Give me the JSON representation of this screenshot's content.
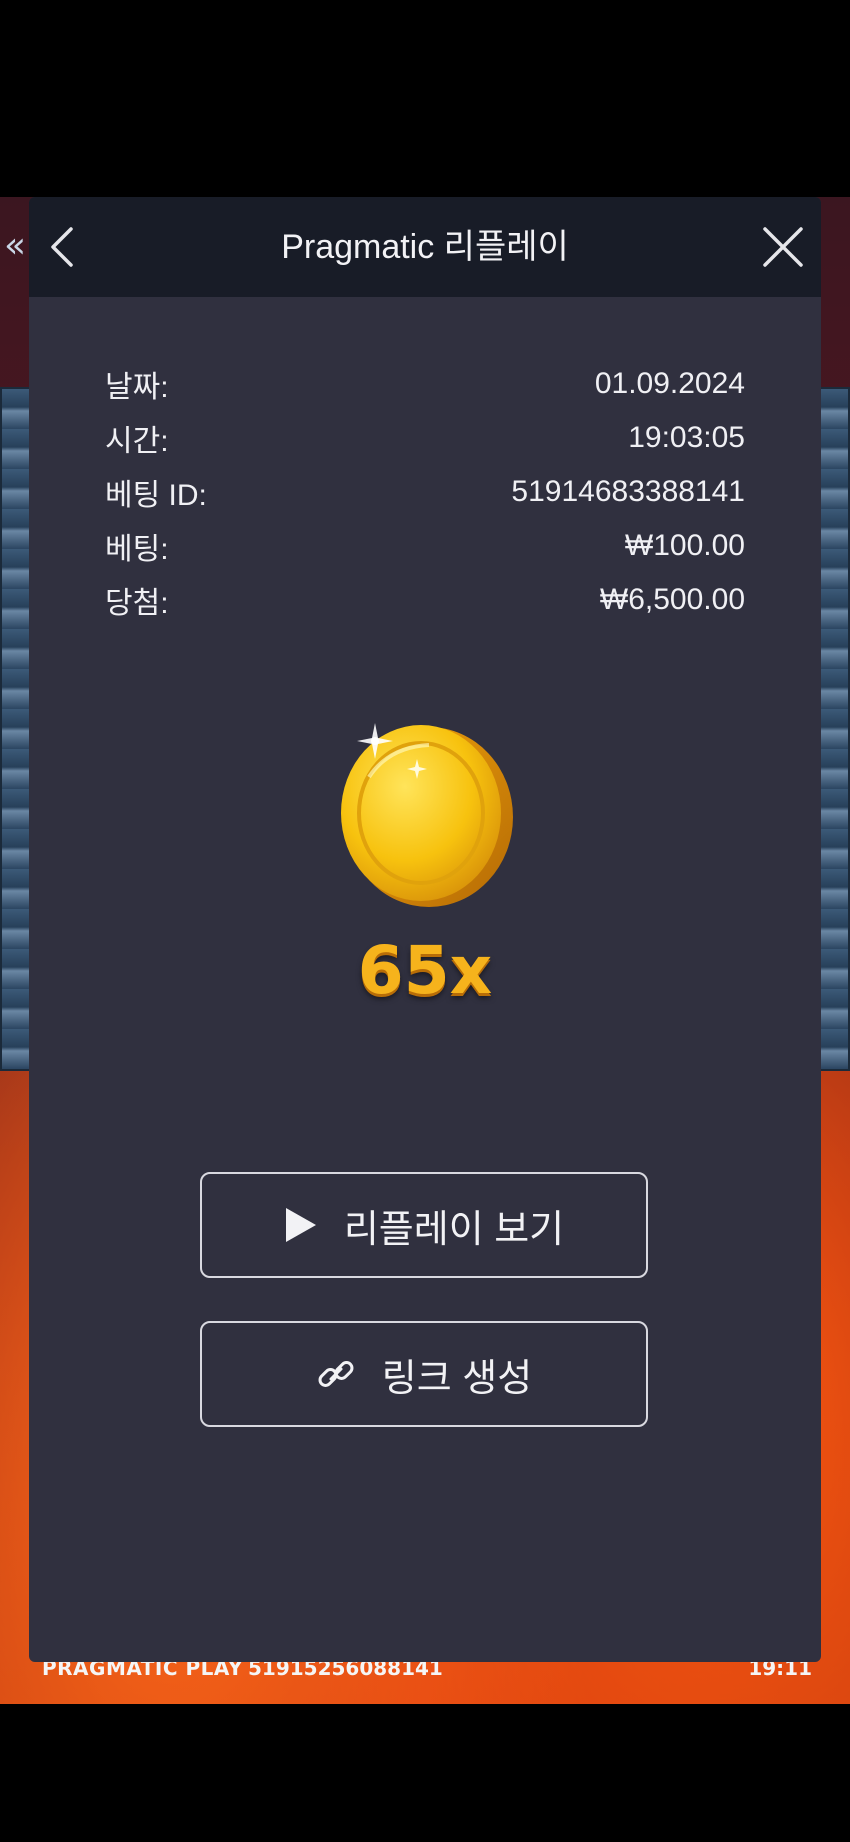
{
  "background": {
    "collapse_icon": "«",
    "bottom_strip": {
      "brand": "PRAGMATIC PLAY",
      "round_id": "51915256088141",
      "time": "19:11"
    }
  },
  "modal": {
    "title": "Pragmatic 리플레이",
    "back_icon": "chevron-left-icon",
    "close_icon": "close-icon",
    "details": [
      {
        "label": "날짜:",
        "value": "01.09.2024"
      },
      {
        "label": "시간:",
        "value": "19:03:05"
      },
      {
        "label": "베팅 ID:",
        "value": "51914683388141"
      },
      {
        "label": "베팅:",
        "value": "₩100.00"
      },
      {
        "label": "당첨:",
        "value": "₩6,500.00"
      }
    ],
    "multiplier": "65x",
    "buttons": {
      "replay_label": "리플레이 보기",
      "link_label": "링크 생성"
    }
  },
  "colors": {
    "modal_bg": "#30303f",
    "header_bg": "#181c27",
    "gold": "#f6b31c"
  }
}
